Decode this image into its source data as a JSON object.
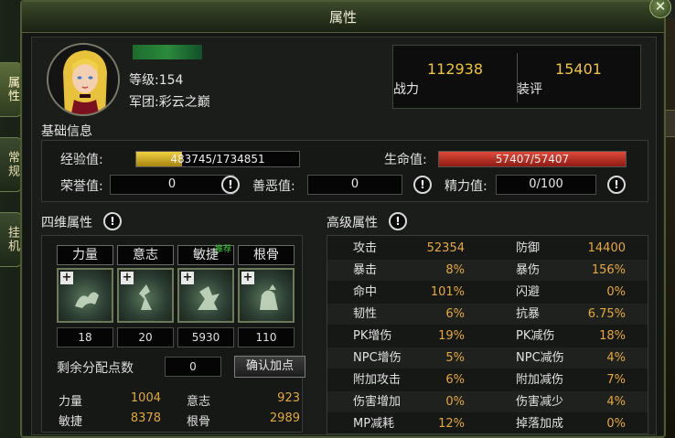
{
  "window": {
    "title": "属性",
    "close_label": "✕"
  },
  "side_tabs": [
    {
      "label": "属性",
      "active": true
    },
    {
      "label": "常规",
      "active": false
    },
    {
      "label": "挂机",
      "active": false
    }
  ],
  "profile": {
    "level": "等级:154",
    "corps": "军团:彩云之巅"
  },
  "power": {
    "combat_value": "112938",
    "combat_label": "战力",
    "gear_value": "15401",
    "gear_label": "装评"
  },
  "basic_info": {
    "title": "基础信息",
    "exp_label": "经验值:",
    "exp_text": "483745/1734851",
    "exp_ratio": 0.2788,
    "hp_label": "生命值:",
    "hp_text": "57407/57407",
    "hp_ratio": 1.0,
    "honor_label": "荣誉值:",
    "honor_value": "0",
    "karma_label": "善恶值:",
    "karma_value": "0",
    "energy_label": "精力值:",
    "energy_value": "0/100",
    "info_glyph": "!"
  },
  "four_dim": {
    "title": "四维属性",
    "attrs": [
      {
        "name": "力量",
        "value": "18",
        "icon": "strength-icon"
      },
      {
        "name": "意志",
        "value": "20",
        "icon": "will-icon"
      },
      {
        "name": "敏捷",
        "value": "5930",
        "icon": "agility-icon",
        "badge": "推荐"
      },
      {
        "name": "根骨",
        "value": "110",
        "icon": "constitution-icon"
      }
    ],
    "plus_glyph": "+",
    "remaining_label": "剩余分配点数",
    "remaining_value": "0",
    "confirm_label": "确认加点",
    "totals": [
      {
        "k": "力量",
        "v": "1004"
      },
      {
        "k": "意志",
        "v": "923"
      },
      {
        "k": "敏捷",
        "v": "8378"
      },
      {
        "k": "根骨",
        "v": "2989"
      }
    ]
  },
  "advanced": {
    "title": "高级属性",
    "rows": [
      {
        "k1": "攻击",
        "v1": "52354",
        "k2": "防御",
        "v2": "14400"
      },
      {
        "k1": "暴击",
        "v1": "8%",
        "k2": "暴伤",
        "v2": "156%"
      },
      {
        "k1": "命中",
        "v1": "101%",
        "k2": "闪避",
        "v2": "0%"
      },
      {
        "k1": "韧性",
        "v1": "6%",
        "k2": "抗暴",
        "v2": "6.75%"
      },
      {
        "k1": "PK增伤",
        "v1": "19%",
        "k2": "PK减伤",
        "v2": "18%"
      },
      {
        "k1": "NPC增伤",
        "v1": "5%",
        "k2": "NPC减伤",
        "v2": "4%"
      },
      {
        "k1": "附加攻击",
        "v1": "6%",
        "k2": "附加减伤",
        "v2": "7%"
      },
      {
        "k1": "伤害增加",
        "v1": "0%",
        "k2": "伤害减少",
        "v2": "4%"
      },
      {
        "k1": "MP减耗",
        "v1": "12%",
        "k2": "掉落加成",
        "v2": "0%"
      }
    ]
  },
  "colors": {
    "value_orange": "#e6a740",
    "power_gold": "#f0c43a",
    "exp_bar": "#d9b21e",
    "hp_bar": "#c42a22",
    "recommend_green": "#38d838"
  }
}
